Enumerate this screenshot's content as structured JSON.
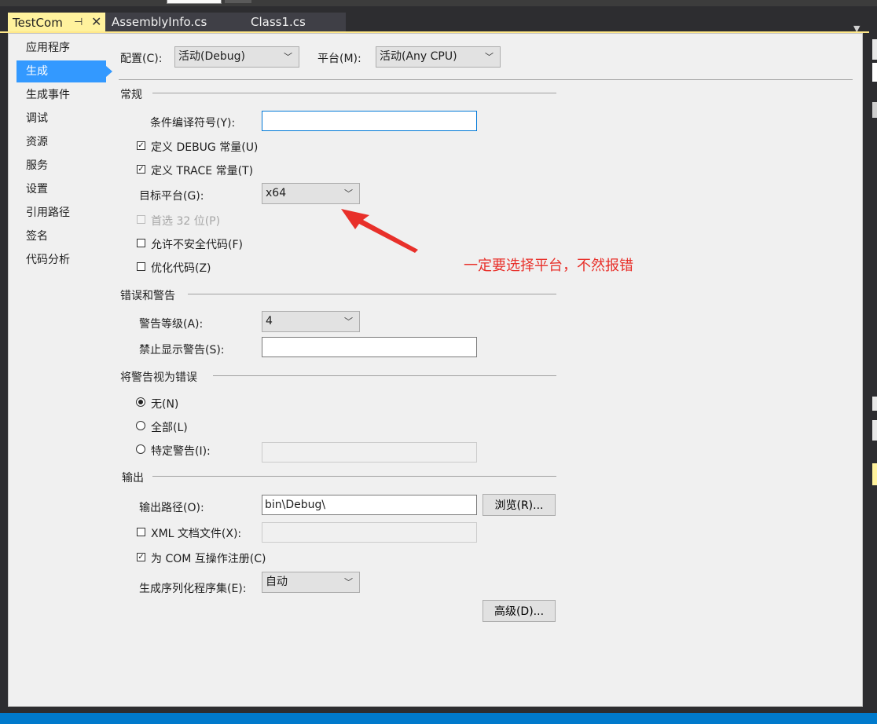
{
  "tabs": {
    "active": "TestCom",
    "others": [
      "AssemblyInfo.cs",
      "Class1.cs"
    ],
    "pin_icon": "pin-icon",
    "close_icon": "close-icon"
  },
  "nav": {
    "items": [
      "应用程序",
      "生成",
      "生成事件",
      "调试",
      "资源",
      "服务",
      "设置",
      "引用路径",
      "签名",
      "代码分析"
    ],
    "selected": "生成"
  },
  "top": {
    "config_label": "配置(C):",
    "config_value": "活动(Debug)",
    "platform_label": "平台(M):",
    "platform_value": "活动(Any CPU)"
  },
  "general": {
    "heading": "常规",
    "cond_symbols_label": "条件编译符号(Y):",
    "cond_symbols_value": "",
    "define_debug_label": "定义 DEBUG 常量(U)",
    "define_debug_checked": true,
    "define_trace_label": "定义 TRACE 常量(T)",
    "define_trace_checked": true,
    "target_platform_label": "目标平台(G):",
    "target_platform_value": "x64",
    "prefer32_label": "首选 32 位(P)",
    "prefer32_checked": false,
    "unsafe_label": "允许不安全代码(F)",
    "unsafe_checked": false,
    "optimize_label": "优化代码(Z)",
    "optimize_checked": false
  },
  "annotation": {
    "text": "一定要选择平台，不然报错",
    "color": "#e8302a"
  },
  "errors": {
    "heading": "错误和警告",
    "warning_level_label": "警告等级(A):",
    "warning_level_value": "4",
    "suppress_label": "禁止显示警告(S):",
    "suppress_value": ""
  },
  "treat_warnings": {
    "heading": "将警告视为错误",
    "options": [
      "无(N)",
      "全部(L)",
      "特定警告(I):"
    ],
    "selected": "无(N)"
  },
  "output": {
    "heading": "输出",
    "path_label": "输出路径(O):",
    "path_value": "bin\\Debug\\",
    "browse_button": "浏览(R)...",
    "xml_doc_label": "XML 文档文件(X):",
    "xml_doc_checked": false,
    "com_label": "为 COM 互操作注册(C)",
    "com_checked": true,
    "serialization_label": "生成序列化程序集(E):",
    "serialization_value": "自动",
    "advanced_button": "高级(D)..."
  },
  "colors": {
    "nav_selected": "#3399ff",
    "tab_active": "#fff29d",
    "statusbar": "#007acc"
  }
}
